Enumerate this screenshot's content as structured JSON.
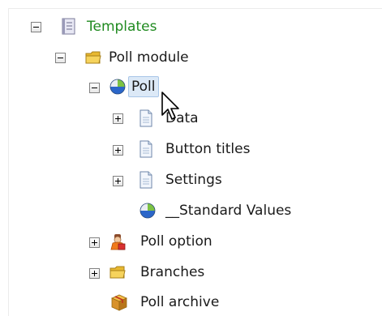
{
  "tree": {
    "templates": {
      "label": "Templates",
      "icon": "template-doc-icon",
      "expanded": true
    },
    "poll_module": {
      "label": "Poll module",
      "icon": "folder-icon",
      "expanded": true
    },
    "poll": {
      "label": "Poll",
      "icon": "poll-sphere-icon",
      "expanded": true,
      "selected": true
    },
    "data": {
      "label": "Data",
      "icon": "document-icon",
      "expanded": false
    },
    "button_titles": {
      "label": "Button titles",
      "icon": "document-icon",
      "expanded": false
    },
    "settings": {
      "label": "Settings",
      "icon": "document-icon",
      "expanded": false
    },
    "standard_values": {
      "label": "__Standard Values",
      "icon": "poll-sphere-icon"
    },
    "poll_option": {
      "label": "Poll option",
      "icon": "poll-option-icon",
      "expanded": false
    },
    "branches": {
      "label": "Branches",
      "icon": "folder-icon",
      "expanded": false
    },
    "poll_archive": {
      "label": "Poll archive",
      "icon": "archive-box-icon"
    }
  },
  "colors": {
    "templates_label": "#1f8a1f",
    "selection_bg": "#dce9f7",
    "selection_border": "#a9c6e8"
  }
}
